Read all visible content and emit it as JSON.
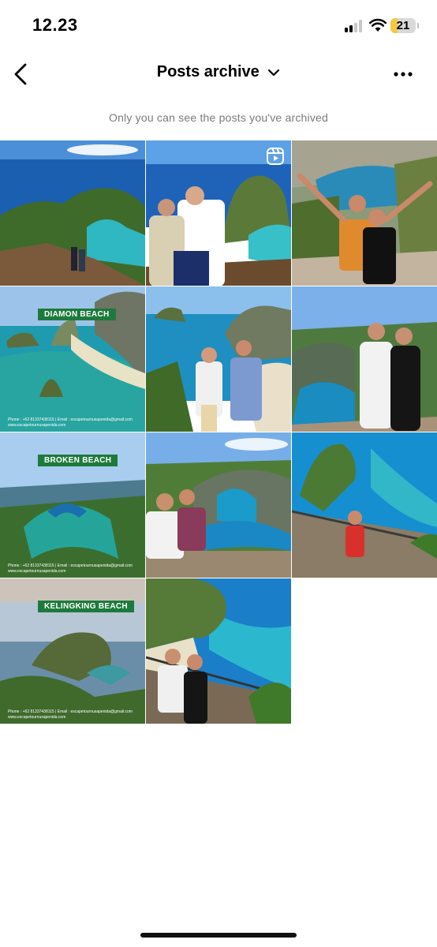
{
  "status_bar": {
    "time": "12.23",
    "battery": "21"
  },
  "header": {
    "title": "Posts archive"
  },
  "notice": "Only you can see the posts you've archived",
  "banners": {
    "diamond": "DIAMON BEACH",
    "broken": "BROKEN BEACH",
    "kelingking": "KELINGKING BEACH"
  },
  "footer": {
    "phone": "Phone : +62 81337438115  |  Email : escapetournusapenida@gmail.com",
    "site": "www.escapetournusapenida.com"
  },
  "colors": {
    "accent_banner": "#1d7a3c",
    "battery": "#f6c842",
    "notice": "#7a7a7a"
  }
}
